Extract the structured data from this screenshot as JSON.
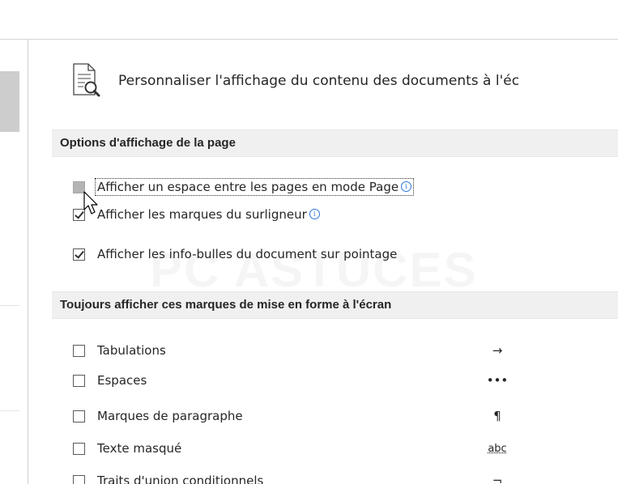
{
  "header": {
    "title": "Personnaliser l'affichage du contenu des documents à l'éc"
  },
  "sections": [
    {
      "label": "Options d'affichage de la page"
    },
    {
      "label": "Toujours afficher ces marques de mise en forme à l'écran"
    }
  ],
  "page_options": [
    {
      "label": "Afficher un espace entre les pages en mode Page",
      "checked": false,
      "info": true,
      "hover": true
    },
    {
      "label": "Afficher les marques du surligneur",
      "checked": true,
      "info": true
    },
    {
      "label": "Afficher les info-bulles du document sur pointage",
      "checked": true,
      "info": false
    }
  ],
  "format_marks": [
    {
      "label": "Tabulations",
      "mark": "→",
      "checked": false
    },
    {
      "label": "Espaces",
      "mark": "•••",
      "checked": false
    },
    {
      "label": "Marques de paragraphe",
      "mark": "¶",
      "checked": false
    },
    {
      "label": "Texte masqué",
      "mark": "abc",
      "checked": false
    },
    {
      "label": "Traits d'union conditionnels",
      "mark": "¬",
      "checked": false
    }
  ],
  "watermark": {
    "text": "PC ASTUCES"
  },
  "icons": {
    "page": "page-search-icon",
    "info": "info-icon",
    "cursor": "mouse-pointer-icon"
  },
  "colors": {
    "accent": "#2f77d8",
    "section_bg": "#f0f0f0",
    "hover_checkbox": "#b4b4b4"
  }
}
